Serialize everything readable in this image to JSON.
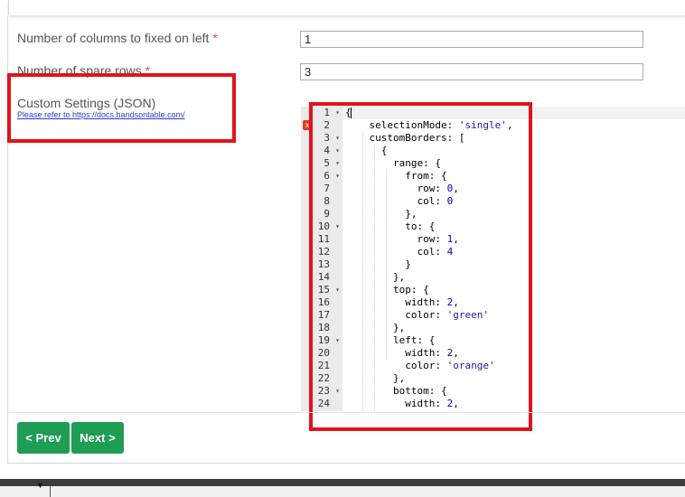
{
  "form": {
    "fixed_columns": {
      "label": "Number of columns to fixed on left",
      "required_mark": "*",
      "value": "1"
    },
    "spare_rows": {
      "label": "Number of spare rows",
      "required_mark": "*",
      "value": "3"
    },
    "custom_settings": {
      "label": "Custom Settings (JSON)",
      "help_text": "Please refer to https://docs.handsontable.com/"
    }
  },
  "editor": {
    "error_marker": "x",
    "lines": [
      {
        "n": "1",
        "fold": true,
        "text": "{"
      },
      {
        "n": "2",
        "fold": false,
        "text": "    selectionMode: 'single',"
      },
      {
        "n": "3",
        "fold": true,
        "text": "    customBorders: ["
      },
      {
        "n": "4",
        "fold": true,
        "text": "      {"
      },
      {
        "n": "5",
        "fold": true,
        "text": "        range: {"
      },
      {
        "n": "6",
        "fold": true,
        "text": "          from: {"
      },
      {
        "n": "7",
        "fold": false,
        "text": "            row: 0,"
      },
      {
        "n": "8",
        "fold": false,
        "text": "            col: 0"
      },
      {
        "n": "9",
        "fold": false,
        "text": "          },"
      },
      {
        "n": "10",
        "fold": true,
        "text": "          to: {"
      },
      {
        "n": "11",
        "fold": false,
        "text": "            row: 1,"
      },
      {
        "n": "12",
        "fold": false,
        "text": "            col: 4"
      },
      {
        "n": "13",
        "fold": false,
        "text": "          }"
      },
      {
        "n": "14",
        "fold": false,
        "text": "        },"
      },
      {
        "n": "15",
        "fold": true,
        "text": "        top: {"
      },
      {
        "n": "16",
        "fold": false,
        "text": "          width: 2,"
      },
      {
        "n": "17",
        "fold": false,
        "text": "          color: 'green'"
      },
      {
        "n": "18",
        "fold": false,
        "text": "        },"
      },
      {
        "n": "19",
        "fold": true,
        "text": "        left: {"
      },
      {
        "n": "20",
        "fold": false,
        "text": "          width: 2,"
      },
      {
        "n": "21",
        "fold": false,
        "text": "          color: 'orange'"
      },
      {
        "n": "22",
        "fold": false,
        "text": "        },"
      },
      {
        "n": "23",
        "fold": true,
        "text": "        bottom: {"
      },
      {
        "n": "24",
        "fold": false,
        "text": "          width: 2,"
      }
    ]
  },
  "buttons": {
    "prev_label": "< Prev",
    "next_label": "Next >"
  },
  "colors": {
    "button_green": "#1f9d55",
    "callout_red": "#e4121c",
    "required_red": "#d9534f",
    "link_blue": "#2b3fc7"
  },
  "icons": {
    "fold": "fold-arrow-icon",
    "error": "error-marker-icon",
    "taskbar": "chevron-down-icon"
  }
}
